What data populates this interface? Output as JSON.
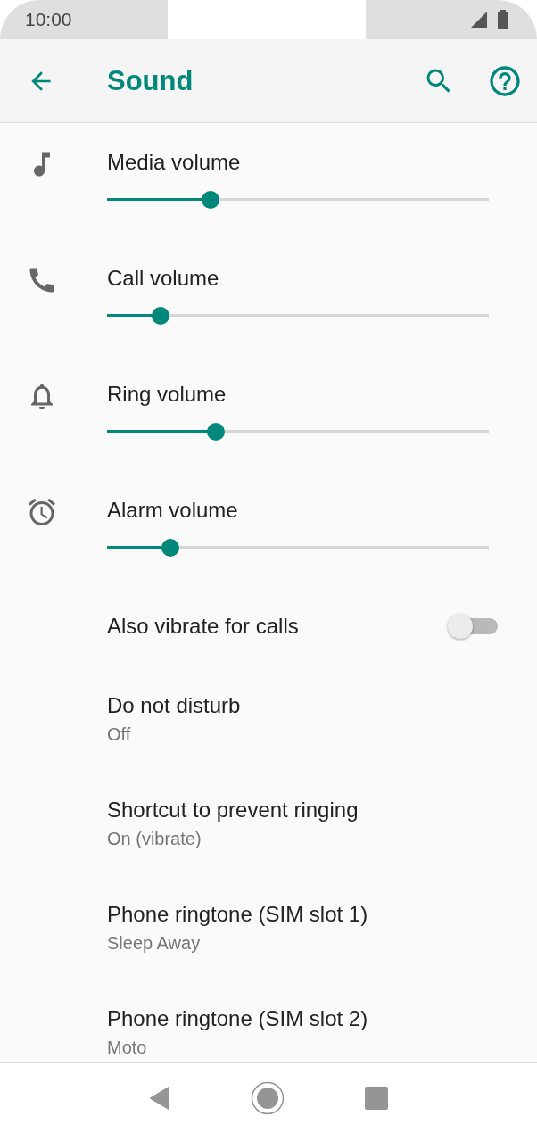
{
  "status_bar": {
    "time": "10:00"
  },
  "toolbar": {
    "title": "Sound"
  },
  "volumes": [
    {
      "label": "Media volume",
      "level": 0.27
    },
    {
      "label": "Call volume",
      "level": 0.14
    },
    {
      "label": "Ring volume",
      "level": 0.285
    },
    {
      "label": "Alarm volume",
      "level": 0.166
    }
  ],
  "vibrate": {
    "label": "Also vibrate for calls",
    "on": false
  },
  "settings": [
    {
      "title": "Do not disturb",
      "summary": "Off"
    },
    {
      "title": "Shortcut to prevent ringing",
      "summary": "On (vibrate)"
    },
    {
      "title": "Phone ringtone (SIM slot 1)",
      "summary": "Sleep Away"
    },
    {
      "title": "Phone ringtone (SIM slot 2)",
      "summary": "Moto"
    }
  ]
}
